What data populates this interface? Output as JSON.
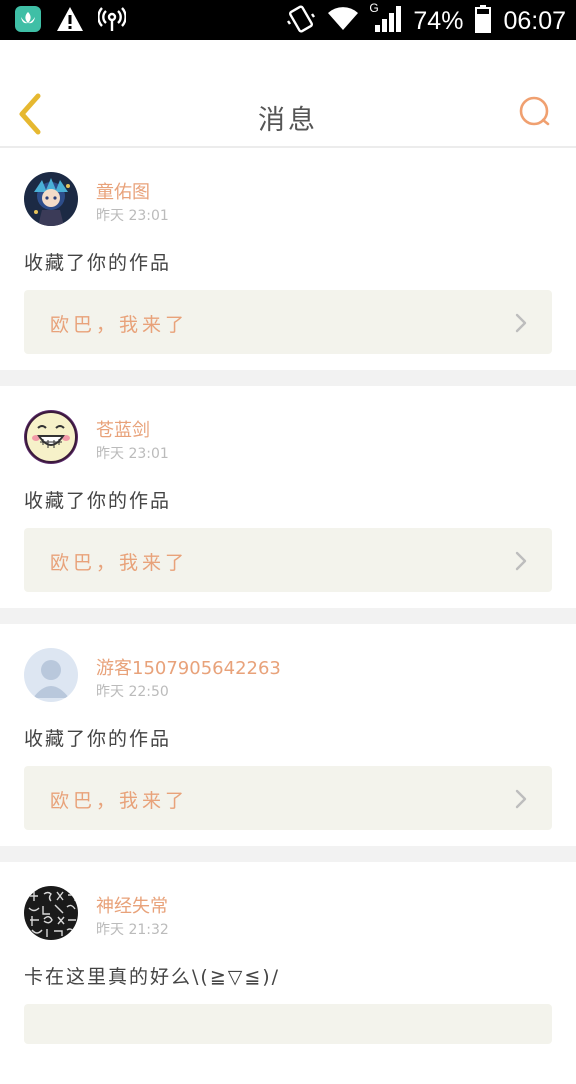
{
  "status_bar": {
    "battery": "74%",
    "time": "06:07",
    "network": "G"
  },
  "header": {
    "title": "消息"
  },
  "messages": [
    {
      "username": "童佑图",
      "time": "昨天 23:01",
      "action": "收藏了你的作品",
      "work_title": "欧巴，我来了",
      "avatar": "anime-avatar"
    },
    {
      "username": "苍蓝剑",
      "time": "昨天 23:01",
      "action": "收藏了你的作品",
      "work_title": "欧巴，我来了",
      "avatar": "laughing-face-avatar"
    },
    {
      "username": "游客1507905642263",
      "time": "昨天 22:50",
      "action": "收藏了你的作品",
      "work_title": "欧巴，我来了",
      "avatar": "default-user-avatar"
    },
    {
      "username": "神经失常",
      "time": "昨天 21:32",
      "action": "卡在这里真的好么\\(≧▽≦)/",
      "work_title": "",
      "avatar": "text-pattern-avatar"
    }
  ],
  "colors": {
    "accent": "#e8a27a",
    "back_arrow": "#e6b830",
    "card_bg": "#f3f3ec",
    "separator": "#f2f2f2"
  }
}
